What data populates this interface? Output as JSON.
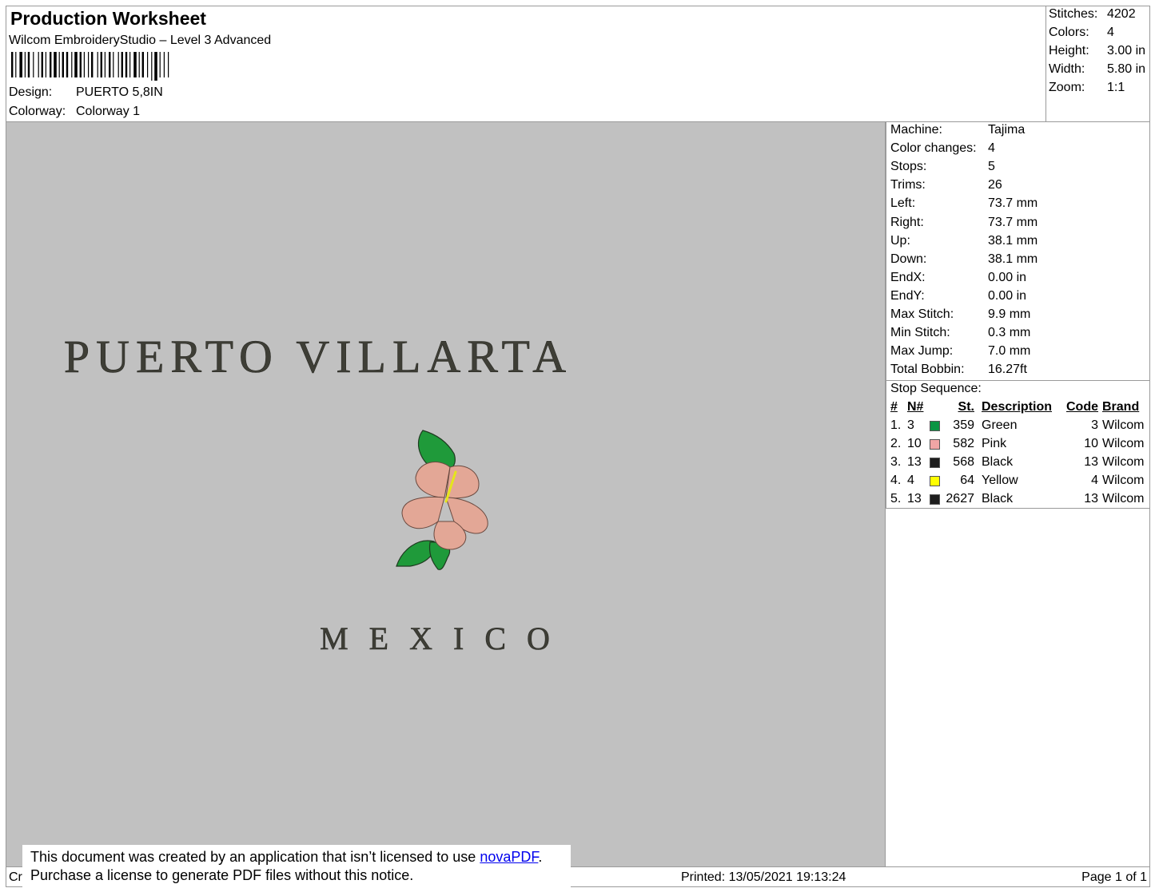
{
  "header": {
    "title": "Production Worksheet",
    "app_name": "Wilcom EmbroideryStudio – Level 3 Advanced",
    "design_label": "Design:",
    "design_value": "PUERTO 5,8IN",
    "colorway_label": "Colorway:",
    "colorway_value": "Colorway 1",
    "stats": [
      {
        "label": "Stitches:",
        "value": "4202"
      },
      {
        "label": "Colors:",
        "value": "4"
      },
      {
        "label": "Height:",
        "value": "3.00 in"
      },
      {
        "label": "Width:",
        "value": "5.80 in"
      },
      {
        "label": "Zoom:",
        "value": "1:1"
      }
    ]
  },
  "design_preview": {
    "line1": "PUERTO VILLARTA",
    "line2": "MEXICO",
    "thread_colors": {
      "text": "#3e3e36",
      "leaf": "#1f9a3a",
      "petal": "#e3a796",
      "stamen": "#e5e51c"
    }
  },
  "machine_info": [
    {
      "label": "Machine:",
      "value": "Tajima"
    },
    {
      "label": "Color changes:",
      "value": "4"
    },
    {
      "label": "Stops:",
      "value": "5"
    },
    {
      "label": "Trims:",
      "value": "26"
    },
    {
      "label": "Left:",
      "value": "73.7 mm"
    },
    {
      "label": "Right:",
      "value": "73.7 mm"
    },
    {
      "label": "Up:",
      "value": "38.1 mm"
    },
    {
      "label": "Down:",
      "value": "38.1 mm"
    },
    {
      "label": "EndX:",
      "value": "0.00 in"
    },
    {
      "label": "EndY:",
      "value": "0.00 in"
    },
    {
      "label": "Max Stitch:",
      "value": "9.9 mm"
    },
    {
      "label": "Min Stitch:",
      "value": "0.3 mm"
    },
    {
      "label": "Max Jump:",
      "value": "7.0 mm"
    },
    {
      "label": "Total Bobbin:",
      "value": "16.27ft"
    }
  ],
  "stop_sequence": {
    "title": "Stop Sequence:",
    "headers": {
      "num": "#",
      "needle": "N#",
      "stitches": "St.",
      "description": "Description",
      "code": "Code",
      "brand": "Brand"
    },
    "rows": [
      {
        "num": "1.",
        "needle": "3",
        "color": "#0a9443",
        "stitches": "359",
        "description": "Green",
        "code": "3",
        "brand": "Wilcom"
      },
      {
        "num": "2.",
        "needle": "10",
        "color": "#f0a5a5",
        "stitches": "582",
        "description": "Pink",
        "code": "10",
        "brand": "Wilcom"
      },
      {
        "num": "3.",
        "needle": "13",
        "color": "#1e1e1e",
        "stitches": "568",
        "description": "Black",
        "code": "13",
        "brand": "Wilcom"
      },
      {
        "num": "4.",
        "needle": "4",
        "color": "#ffff00",
        "stitches": "64",
        "description": "Yellow",
        "code": "4",
        "brand": "Wilcom"
      },
      {
        "num": "5.",
        "needle": "13",
        "color": "#1e1e1e",
        "stitches": "2627",
        "description": "Black",
        "code": "13",
        "brand": "Wilcom"
      }
    ]
  },
  "footer": {
    "created_prefix": "Cr",
    "printed": "Printed: 13/05/2021 19:13:24",
    "page": "Page 1 of 1"
  },
  "notice": {
    "line1_before": "This document was created by an application that isn’t licensed to use ",
    "link": "novaPDF",
    "line1_after": ".",
    "line2": "Purchase a license to generate PDF files without this notice."
  }
}
